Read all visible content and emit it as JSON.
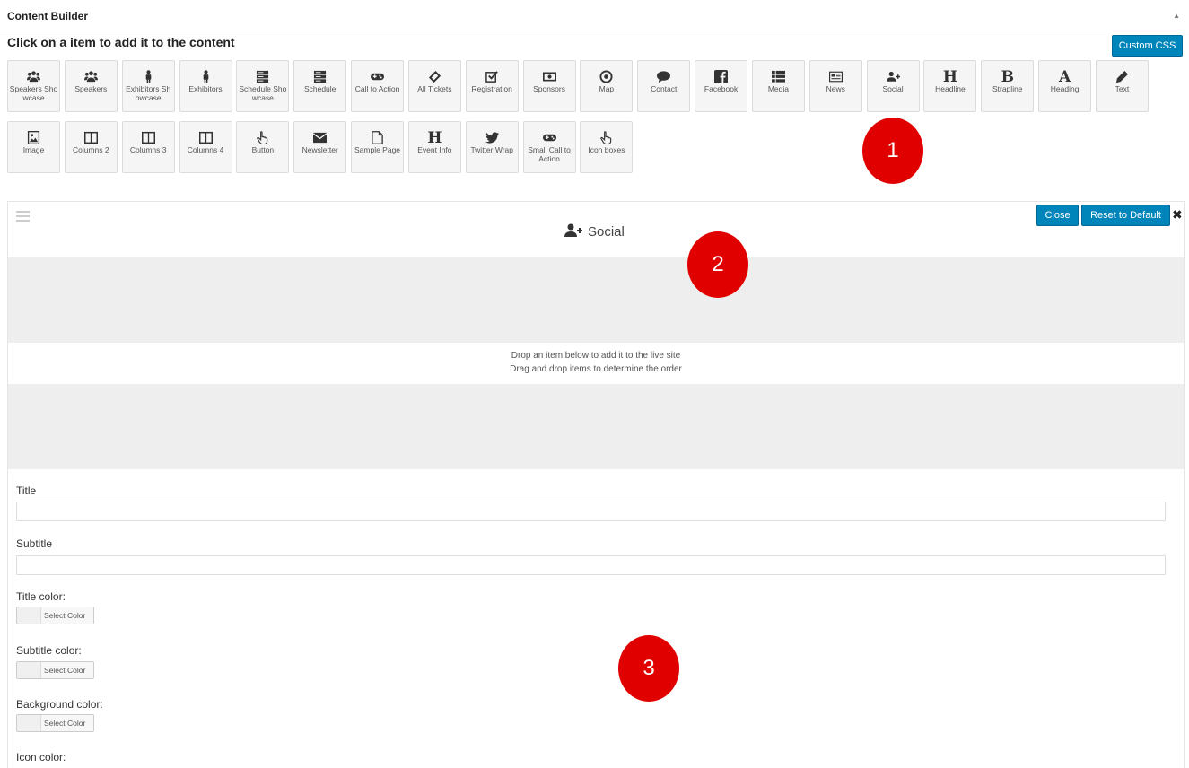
{
  "panel": {
    "title": "Content Builder",
    "toggle": "▲"
  },
  "instruction": "Click on a item to add it to the content",
  "custom_css_label": "Custom CSS",
  "items_row1": [
    {
      "label": "Speakers Sho wcase",
      "icon": "users-icon"
    },
    {
      "label": "Speakers",
      "icon": "users-icon"
    },
    {
      "label": "Exhibitors Sh owcase",
      "icon": "person-icon"
    },
    {
      "label": "Exhibitors",
      "icon": "person-icon"
    },
    {
      "label": "Schedule Sho wcase",
      "icon": "server-icon"
    },
    {
      "label": "Schedule",
      "icon": "server-icon"
    },
    {
      "label": "Call to Action",
      "icon": "gamepad-icon"
    },
    {
      "label": "All Tickets",
      "icon": "ticket-icon"
    },
    {
      "label": "Registration",
      "icon": "checkbox-icon"
    },
    {
      "label": "Sponsors",
      "icon": "money-icon"
    },
    {
      "label": "Map",
      "icon": "target-icon"
    },
    {
      "label": "Contact",
      "icon": "comment-icon"
    },
    {
      "label": "Facebook",
      "icon": "facebook-icon"
    },
    {
      "label": "Media",
      "icon": "list-icon"
    },
    {
      "label": "News",
      "icon": "newspaper-icon"
    },
    {
      "label": "Social",
      "icon": "user-plus-icon"
    },
    {
      "label": "Headline",
      "icon": "header-icon"
    },
    {
      "label": "Strapline",
      "icon": "bold-icon"
    },
    {
      "label": "Heading",
      "icon": "font-icon"
    },
    {
      "label": "Text",
      "icon": "pencil-icon"
    }
  ],
  "items_row2": [
    {
      "label": "Image",
      "icon": "image-icon"
    },
    {
      "label": "Columns 2",
      "icon": "columns-icon"
    },
    {
      "label": "Columns 3",
      "icon": "columns-icon"
    },
    {
      "label": "Columns 4",
      "icon": "columns-icon"
    },
    {
      "label": "Button",
      "icon": "hand-pointer-icon"
    },
    {
      "label": "Newsletter",
      "icon": "envelope-icon"
    },
    {
      "label": "Sample Page",
      "icon": "file-icon"
    },
    {
      "label": "Event Info",
      "icon": "header-icon"
    },
    {
      "label": "Twitter Wrap",
      "icon": "twitter-icon"
    },
    {
      "label": "Small Call to Action",
      "icon": "gamepad-icon"
    },
    {
      "label": "Icon boxes",
      "icon": "hand-pointer-icon"
    }
  ],
  "markers": [
    "1",
    "2",
    "3"
  ],
  "section": {
    "title": "Social",
    "close_label": "Close",
    "reset_label": "Reset to Default",
    "remove_glyph": "✖",
    "drop_line1": "Drop an item below to add it to the live site",
    "drop_line2": "Drag and drop items to determine the order"
  },
  "fields": {
    "title_label": "Title",
    "title_value": "",
    "subtitle_label": "Subtitle",
    "subtitle_value": "",
    "title_color_label": "Title color:",
    "subtitle_color_label": "Subtitle color:",
    "background_color_label": "Background color:",
    "icon_color_label": "Icon color:",
    "select_color": "Select Color"
  },
  "colors": {
    "accent": "#0085ba",
    "marker": "#e00000"
  }
}
